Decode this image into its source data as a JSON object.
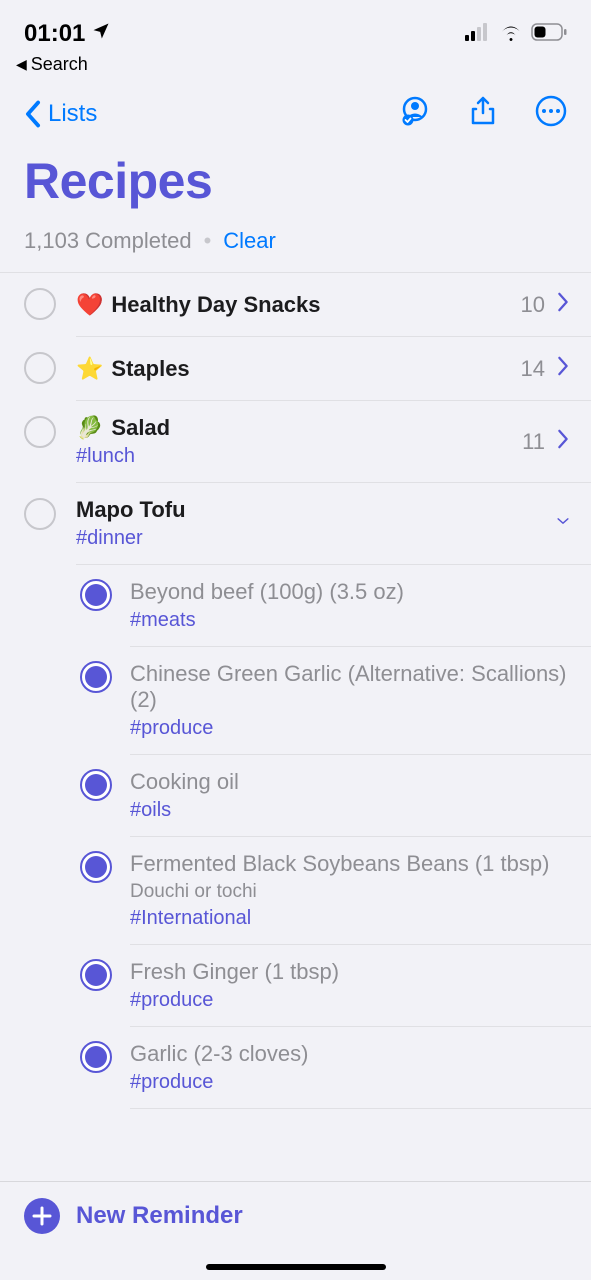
{
  "status": {
    "time": "01:01",
    "breadcrumb": "Search"
  },
  "nav": {
    "back_label": "Lists"
  },
  "title": "Recipes",
  "completed": {
    "text": "1,103 Completed",
    "clear": "Clear"
  },
  "items": [
    {
      "emoji": "❤️",
      "title": "Healthy Day Snacks",
      "count": "10"
    },
    {
      "emoji": "⭐",
      "title": "Staples",
      "count": "14"
    },
    {
      "emoji": "🥬",
      "title": "Salad",
      "count": "11",
      "tag": "#lunch"
    }
  ],
  "expanded": {
    "title": "Mapo Tofu",
    "tag": "#dinner",
    "subs": [
      {
        "title": "Beyond beef (100g) (3.5 oz)",
        "tag": "#meats"
      },
      {
        "title": "Chinese Green Garlic (Alternative: Scallions) (2)",
        "tag": "#produce"
      },
      {
        "title": "Cooking oil",
        "tag": "#oils"
      },
      {
        "title": "Fermented Black Soybeans Beans (1 tbsp)",
        "note": "Douchi or tochi",
        "tag": "#International"
      },
      {
        "title": "Fresh Ginger (1 tbsp)",
        "tag": "#produce"
      },
      {
        "title": "Garlic (2-3 cloves)",
        "tag": "#produce"
      }
    ]
  },
  "footer": {
    "new_reminder": "New Reminder"
  }
}
